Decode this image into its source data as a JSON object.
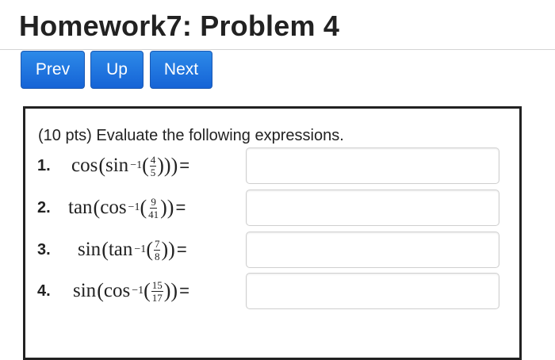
{
  "page": {
    "title": "Homework7: Problem 4"
  },
  "nav": {
    "prev_label": "Prev",
    "up_label": "Up",
    "next_label": "Next"
  },
  "problem": {
    "prompt": "(10 pts) Evaluate the following expressions.",
    "items": [
      {
        "number": "1.",
        "outer": "cos",
        "inner": "sin",
        "exp": "−1",
        "numerator": "4",
        "denominator": "5",
        "open": "((",
        "close": ")))",
        "eq": "=",
        "answer": ""
      },
      {
        "number": "2.",
        "outer": "tan",
        "inner": "cos",
        "exp": "−1",
        "numerator": "9",
        "denominator": "41",
        "open": "((",
        "close": "))",
        "eq": "=",
        "answer": ""
      },
      {
        "number": "3.",
        "outer": "sin",
        "inner": "tan",
        "exp": "−1",
        "numerator": "7",
        "denominator": "8",
        "open": "((",
        "close": "))",
        "eq": "=",
        "answer": ""
      },
      {
        "number": "4.",
        "outer": "sin",
        "inner": "cos",
        "exp": "−1",
        "numerator": "15",
        "denominator": "17",
        "open": "((",
        "close": "))",
        "eq": "=",
        "answer": ""
      }
    ]
  },
  "colors": {
    "button_bg": "#1f74e0",
    "button_text": "#ffffff",
    "box_border": "#222222"
  }
}
